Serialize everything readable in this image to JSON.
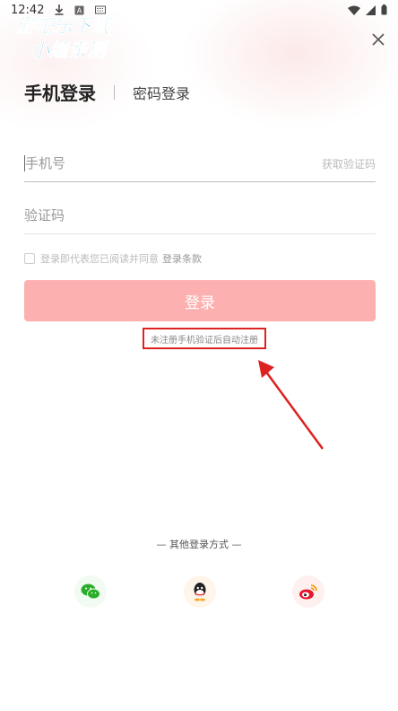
{
  "status_bar": {
    "time": "12:42",
    "icons": [
      "download-icon",
      "a-icon",
      "keyboard-icon",
      "wifi-icon",
      "signal-icon",
      "battery-icon"
    ]
  },
  "watermark": {
    "line1": "游吧乐下载",
    "line2": "小编亲测"
  },
  "tabs": {
    "active": "手机登录",
    "inactive": "密码登录"
  },
  "form": {
    "phone_placeholder": "手机号",
    "get_code_label": "获取验证码",
    "code_placeholder": "验证码",
    "agree_text": "登录即代表您已阅读并同意",
    "terms_link": "登录条款",
    "login_button": "登录",
    "auto_register_note": "未注册手机验证后自动注册"
  },
  "other_login": {
    "title": "— 其他登录方式 —",
    "providers": [
      "wechat-icon",
      "qq-icon",
      "weibo-icon"
    ]
  },
  "colors": {
    "login_button": "#fdb0b0",
    "annotation": "#dd2222",
    "wechat": "#2aae2a",
    "weibo": "#e6162d"
  }
}
